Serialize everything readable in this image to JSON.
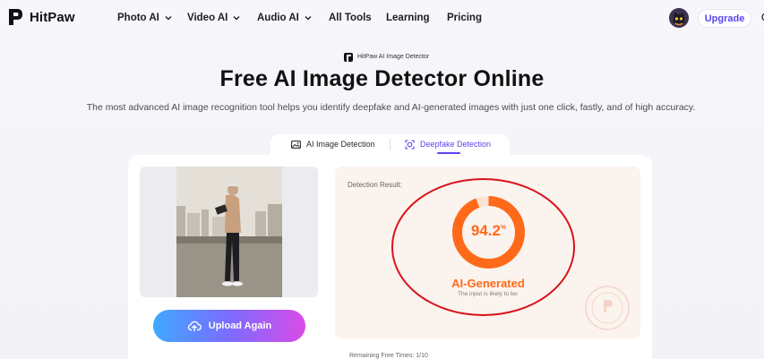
{
  "brand": {
    "name": "HitPaw"
  },
  "nav": {
    "items": [
      {
        "label": "Photo AI",
        "has_dropdown": true
      },
      {
        "label": "Video AI",
        "has_dropdown": true
      },
      {
        "label": "Audio AI",
        "has_dropdown": true
      },
      {
        "label": "All Tools",
        "has_dropdown": false
      },
      {
        "label": "Learning",
        "has_dropdown": false
      },
      {
        "label": "Pricing",
        "has_dropdown": false
      }
    ],
    "upgrade_label": "Upgrade"
  },
  "hero": {
    "badge": "HitPaw AI Image Detector",
    "title": "Free AI Image Detector Online",
    "subtitle": "The most advanced AI image recognition tool helps you identify deepfake and AI-generated images with just one click, fastly, and of high accuracy."
  },
  "tabs": [
    {
      "label": "AI Image Detection",
      "active": false
    },
    {
      "label": "Deepfake Detection",
      "active": true
    }
  ],
  "upload": {
    "button_label": "Upload Again"
  },
  "remaining": "Remaining Free Times: 1/10",
  "result": {
    "label": "Detection Result:",
    "score": 94.2,
    "score_text": "94.2",
    "score_unit": "%",
    "verdict": "AI-Generated",
    "note": "The input is likely to be:"
  },
  "colors": {
    "accent": "#5a45f0",
    "result": "#ff6a1a",
    "highlight": "#d9121b"
  }
}
